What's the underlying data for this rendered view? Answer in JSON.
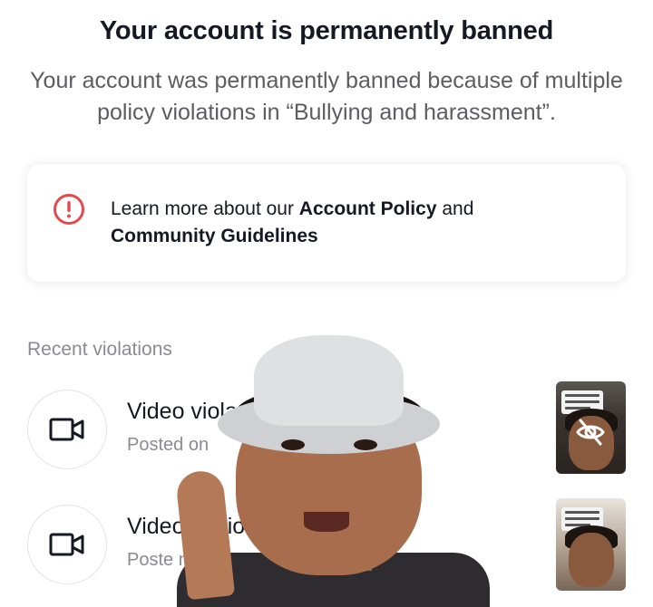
{
  "header": {
    "title": "Your account is permanently banned",
    "description": "Your account was permanently banned because of multiple policy violations in “Bullying and harassment”."
  },
  "policy_card": {
    "icon": "alert-circle-icon",
    "prefix": "Learn more about our ",
    "account_policy_link": "Account Policy",
    "conjunction": " and",
    "community_guidelines_link": "Community Guidelines"
  },
  "violations": {
    "section_label": "Recent violations",
    "items": [
      {
        "icon": "video-camera-icon",
        "title": "Video viola",
        "subtitle": "Posted on"
      },
      {
        "icon": "video-camera-icon",
        "title": "Video  olatio",
        "subtitle": "Poste  n 03/2"
      }
    ]
  },
  "colors": {
    "alert_red": "#e04b50",
    "text_primary": "#161823",
    "text_secondary": "#8a8b91"
  }
}
